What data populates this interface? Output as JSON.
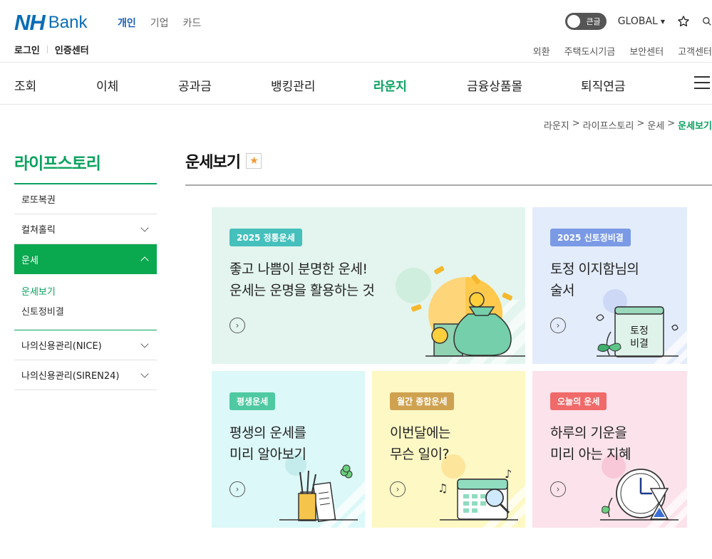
{
  "header": {
    "logo_nh": "NH",
    "logo_bank": "Bank",
    "segments": [
      "개인",
      "기업",
      "카드"
    ],
    "toggle_label": "큰글",
    "global_label": "GLOBAL",
    "login": "로그인",
    "cert": "인증센터",
    "util_links": [
      "외환",
      "주택도시기금",
      "보안센터",
      "고객센터"
    ]
  },
  "nav": [
    "조회",
    "이체",
    "공과금",
    "뱅킹관리",
    "라운지",
    "금융상품몰",
    "퇴직연금"
  ],
  "breadcrumb": [
    "라운지",
    "라이프스토리",
    "운세",
    "운세보기"
  ],
  "sidebar": {
    "title": "라이프스토리",
    "items": [
      "로또복권",
      "컬쳐홀릭",
      "운세",
      "나의신용관리(NICE)",
      "나의신용관리(SIREN24)"
    ],
    "subitems": [
      "운세보기",
      "신토정비결"
    ]
  },
  "main": {
    "title": "운세보기",
    "cards": [
      {
        "badge": "2025 정통운세",
        "line1": "좋고 나쁨이 분명한 운세!",
        "line2": "운세는 운명을 활용하는 것"
      },
      {
        "badge": "2025 신토정비결",
        "line1": "토정 이지함님의",
        "line2": "술서",
        "book_l1": "토정",
        "book_l2": "비결"
      },
      {
        "badge": "평생운세",
        "line1": "평생의 운세를",
        "line2": "미리 알아보기"
      },
      {
        "badge": "월간 종합운세",
        "line1": "이번달에는",
        "line2": "무슨 일이?"
      },
      {
        "badge": "오늘의 운세",
        "line1": "하루의 기운을",
        "line2": "미리 아는 지혜"
      }
    ]
  },
  "colors": {
    "brand_blue": "#0a6db5",
    "green": "#0aa25f",
    "card1_bg": "#e3f5ee",
    "card2_bg": "#e3ecfb",
    "card3_bg": "#dcf8f8",
    "card4_bg": "#fdf8c4",
    "card5_bg": "#fbe2eb"
  }
}
